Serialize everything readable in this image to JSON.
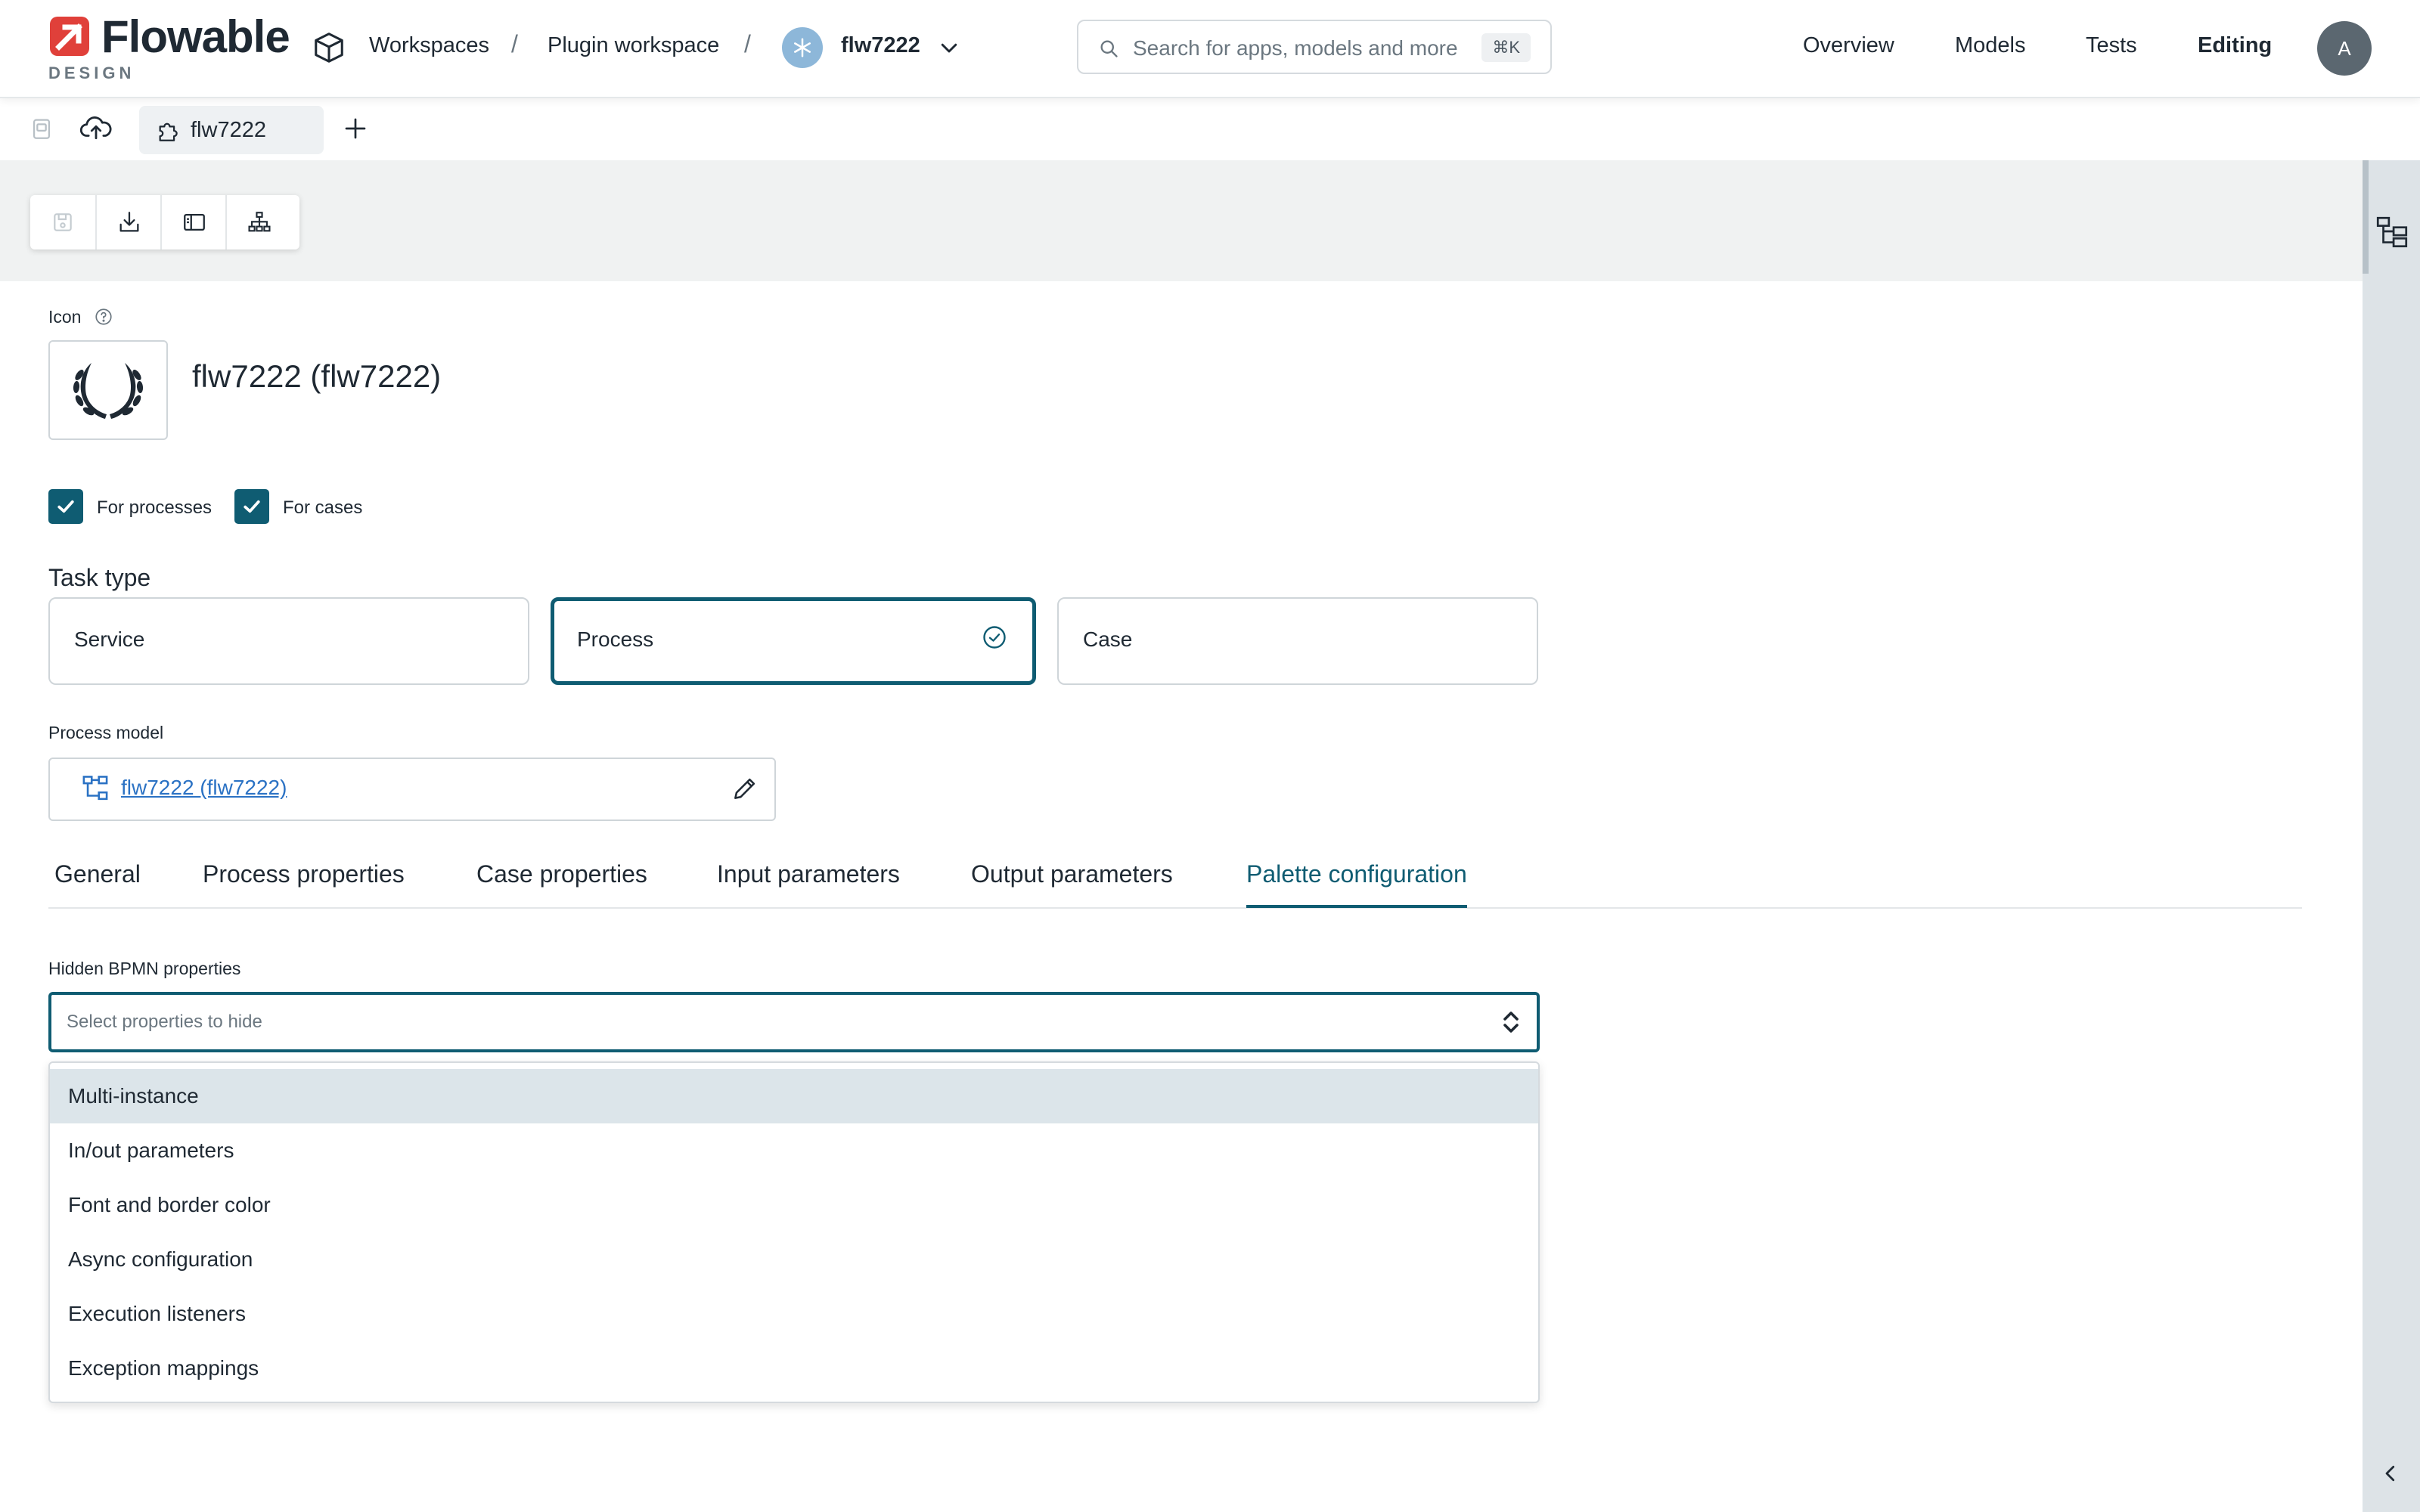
{
  "brand": {
    "name": "Flowable",
    "sub": "DESIGN",
    "color": "#e0403a"
  },
  "breadcrumb": {
    "workspaces": "Workspaces",
    "separator": "/",
    "workspace": "Plugin workspace",
    "app": "flw7222"
  },
  "search": {
    "placeholder": "Search for apps, models and more",
    "shortcut": "⌘K"
  },
  "nav": {
    "overview": "Overview",
    "models": "Models",
    "tests": "Tests",
    "editing": "Editing"
  },
  "user": {
    "initial": "A"
  },
  "editor_tab": {
    "label": "flw7222"
  },
  "form": {
    "icon_label": "Icon",
    "title": "flw7222 (flw7222)",
    "checkboxes": {
      "processes": {
        "label": "For processes",
        "checked": true
      },
      "cases": {
        "label": "For cases",
        "checked": true
      }
    },
    "task_type": {
      "title": "Task type",
      "options": {
        "service": "Service",
        "process": "Process",
        "case": "Case"
      },
      "selected": "Process"
    },
    "process_model": {
      "label": "Process model",
      "value": "flw7222 (flw7222)"
    }
  },
  "tabs": {
    "general": "General",
    "process_properties": "Process properties",
    "case_properties": "Case properties",
    "input_parameters": "Input parameters",
    "output_parameters": "Output parameters",
    "palette_configuration": "Palette configuration",
    "active": "Palette configuration"
  },
  "hidden_props": {
    "label": "Hidden BPMN properties",
    "placeholder": "Select properties to hide",
    "options": {
      "multi_instance": "Multi-instance",
      "in_out": "In/out parameters",
      "font_border": "Font and border color",
      "async": "Async configuration",
      "listeners": "Execution listeners",
      "exceptions": "Exception mappings"
    },
    "highlighted": "Multi-instance"
  },
  "colors": {
    "accent": "#0f5c72",
    "link": "#2b72c4",
    "rail": "#dde3e7"
  }
}
